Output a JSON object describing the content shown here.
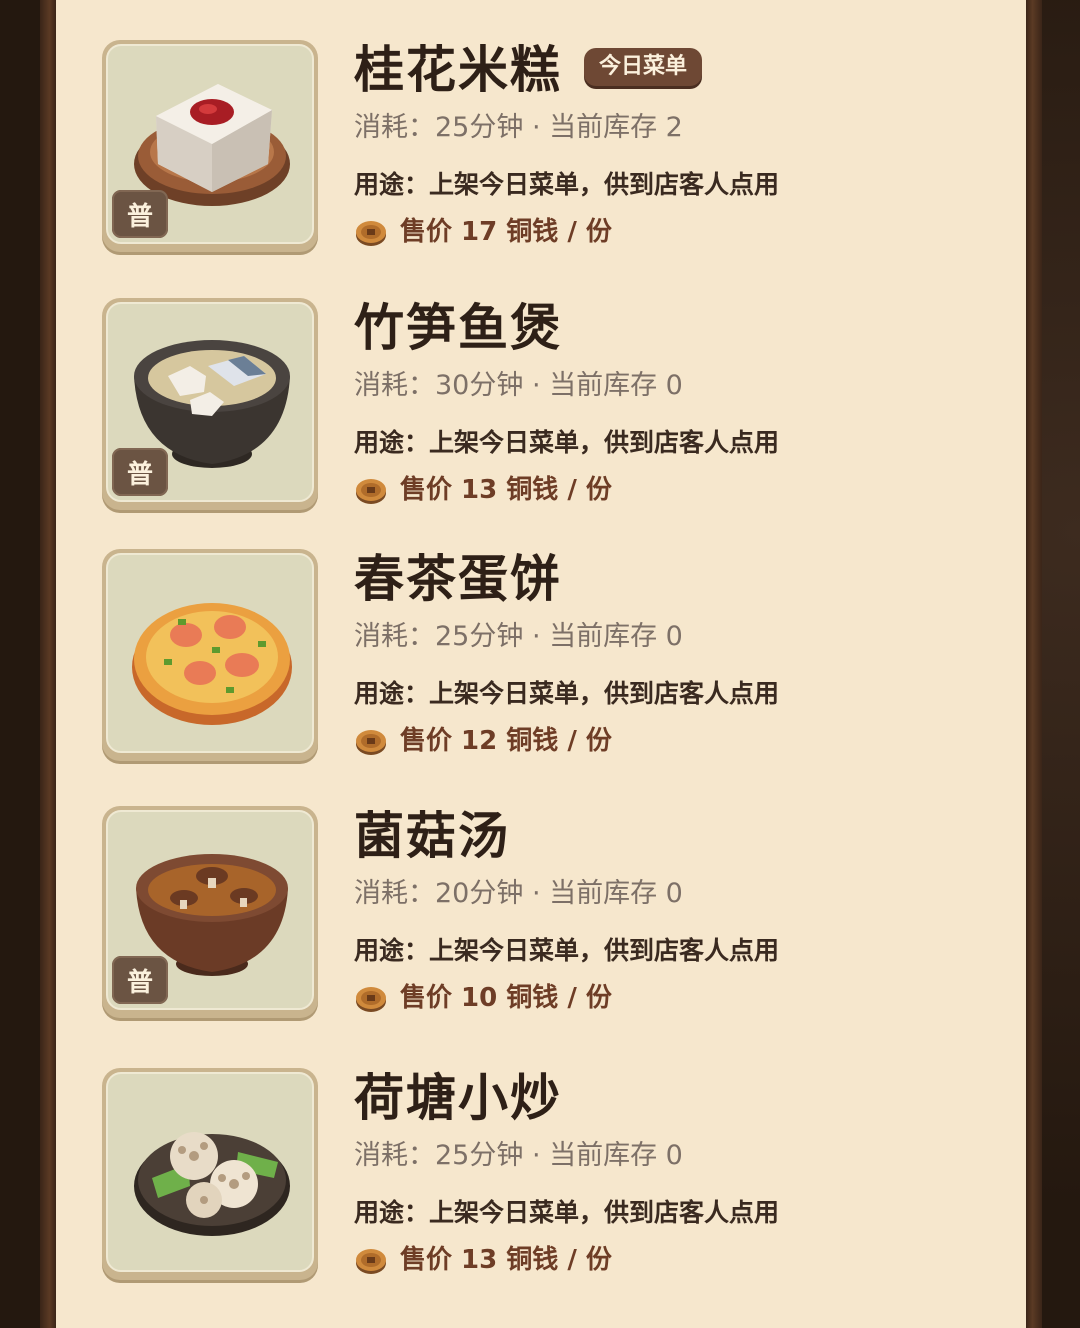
{
  "today_menu_tag": "今日菜单",
  "items": [
    {
      "name": "桂花米糕",
      "meta": "消耗：25分钟 · 当前库存 2",
      "usage": "用途：上架今日菜单，供到店客人点用",
      "price": "售价 17 铜钱 / 份",
      "grade": "普",
      "icon": "rice-cake-icon"
    },
    {
      "name": "竹笋鱼煲",
      "meta": "消耗：30分钟 · 当前库存 0",
      "usage": "用途：上架今日菜单，供到店客人点用",
      "price": "售价 13 铜钱 / 份",
      "grade": "普",
      "icon": "fish-stew-icon"
    },
    {
      "name": "春茶蛋饼",
      "meta": "消耗：25分钟 · 当前库存 0",
      "usage": "用途：上架今日菜单，供到店客人点用",
      "price": "售价 12 铜钱 / 份",
      "grade": "",
      "icon": "egg-pancake-icon"
    },
    {
      "name": "菌菇汤",
      "meta": "消耗：20分钟 · 当前库存 0",
      "usage": "用途：上架今日菜单，供到店客人点用",
      "price": "售价 10 铜钱 / 份",
      "grade": "普",
      "icon": "mushroom-soup-icon"
    },
    {
      "name": "荷塘小炒",
      "meta": "消耗：25分钟 · 当前库存 0",
      "usage": "用途：上架今日菜单，供到店客人点用",
      "price": "售价 13 铜钱 / 份",
      "grade": "",
      "icon": "lotus-stirfry-icon"
    }
  ]
}
